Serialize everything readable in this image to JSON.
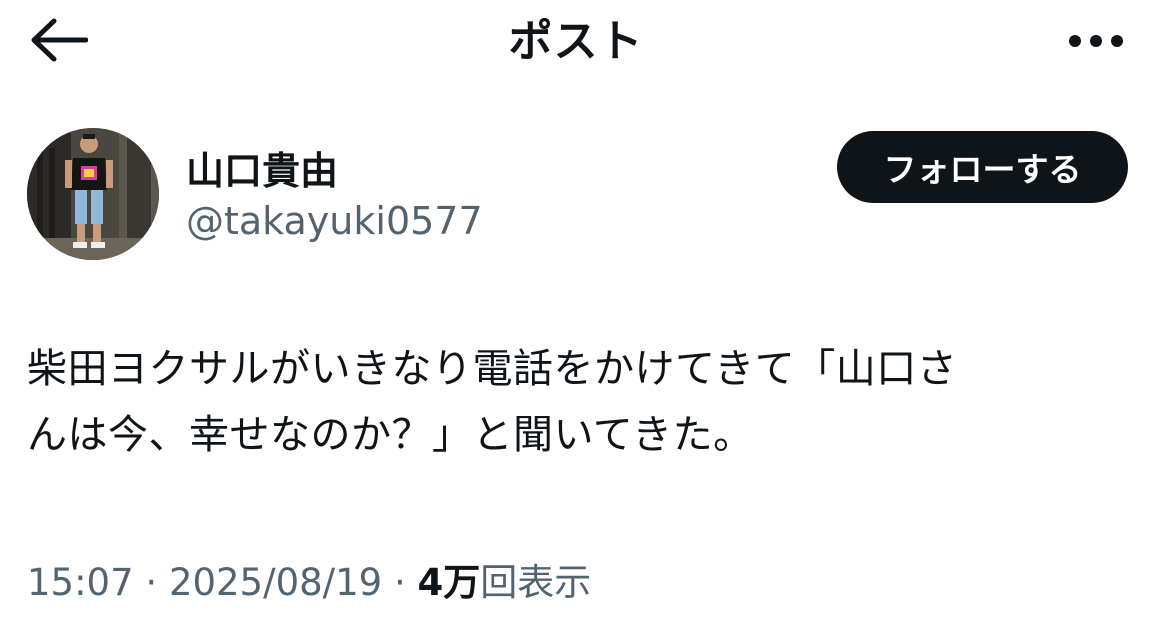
{
  "header": {
    "title": "ポスト",
    "back_icon": "arrow-left-icon",
    "more_icon": "more-horizontal-icon"
  },
  "author": {
    "display_name": "山口貴由",
    "handle": "@takayuki0577",
    "avatar_icon": "avatar-photo"
  },
  "follow_button": {
    "label": "フォローする"
  },
  "post": {
    "text_line1": "柴田ヨクサルがいきなり電話をかけてきて「山口さ",
    "text_line2": "んは今、幸せなのか？」と聞いてきた。"
  },
  "meta": {
    "time": "15:07",
    "separator": " · ",
    "date": "2025/08/19",
    "views_count": "4万",
    "views_label": "回表示"
  },
  "colors": {
    "text": "#0f1419",
    "secondary": "#536471",
    "button_bg": "#0f1419",
    "button_text": "#ffffff"
  }
}
